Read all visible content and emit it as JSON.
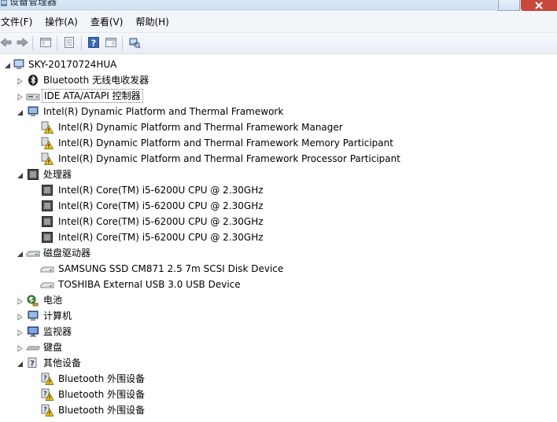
{
  "window": {
    "title": "设备管理器"
  },
  "menu": {
    "file": "文件(F)",
    "action": "操作(A)",
    "view": "查看(V)",
    "help": "帮助(H)"
  },
  "toolbar": {
    "icons": [
      "back-icon",
      "forward-icon",
      "properties-panel-icon",
      "show-hide-icon",
      "help-icon",
      "action-pane-icon",
      "scan-hardware-icon"
    ]
  },
  "tree": {
    "root": "SKY-20170724HUA",
    "bluetooth": "Bluetooth 无线电收发器",
    "ide": "IDE ATA/ATAPI 控制器",
    "intel_framework": "Intel(R) Dynamic Platform and Thermal Framework",
    "intel_children": [
      "Intel(R) Dynamic Platform and Thermal Framework Manager",
      "Intel(R) Dynamic Platform and Thermal Framework Memory Participant",
      "Intel(R) Dynamic Platform and Thermal Framework Processor Participant"
    ],
    "processor": "处理器",
    "processor_children": [
      "Intel(R) Core(TM) i5-6200U CPU @ 2.30GHz",
      "Intel(R) Core(TM) i5-6200U CPU @ 2.30GHz",
      "Intel(R) Core(TM) i5-6200U CPU @ 2.30GHz",
      "Intel(R) Core(TM) i5-6200U CPU @ 2.30GHz"
    ],
    "disk": "磁盘驱动器",
    "disk_children": [
      "SAMSUNG SSD CM871 2.5 7m SCSI Disk Device",
      "TOSHIBA External USB 3.0 USB Device"
    ],
    "battery": "电池",
    "computer": "计算机",
    "monitor": "监视器",
    "keyboard": "键盘",
    "other": "其他设备",
    "other_children": [
      "Bluetooth 外围设备",
      "Bluetooth 外围设备",
      "Bluetooth 外围设备"
    ]
  },
  "colors": {
    "warning": "#f5c518",
    "selection_border": "#5b6f8c",
    "menubar_bg": "#f2f5fa"
  }
}
